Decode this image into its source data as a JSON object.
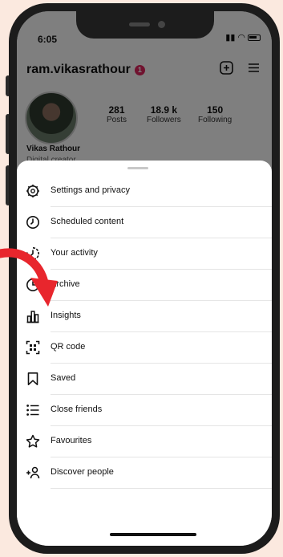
{
  "status": {
    "time": "6:05"
  },
  "profile": {
    "username": "ram.vikasrathour",
    "notification_count": "1",
    "name": "Vikas Rathour",
    "category": "Digital creator",
    "stats": [
      {
        "value": "281",
        "label": "Posts"
      },
      {
        "value": "18.9 k",
        "label": "Followers"
      },
      {
        "value": "150",
        "label": "Following"
      }
    ]
  },
  "menu": {
    "items": [
      {
        "label": "Settings and privacy",
        "icon": "settings-gear-icon"
      },
      {
        "label": "Scheduled content",
        "icon": "clock-icon"
      },
      {
        "label": "Your activity",
        "icon": "activity-icon"
      },
      {
        "label": "Archive",
        "icon": "archive-icon"
      },
      {
        "label": "Insights",
        "icon": "insights-bar-chart-icon"
      },
      {
        "label": "QR code",
        "icon": "qr-code-icon"
      },
      {
        "label": "Saved",
        "icon": "bookmark-icon"
      },
      {
        "label": "Close friends",
        "icon": "close-friends-list-icon"
      },
      {
        "label": "Favourites",
        "icon": "star-icon"
      },
      {
        "label": "Discover people",
        "icon": "add-person-icon"
      }
    ]
  },
  "colors": {
    "page_bg": "#fbe9df",
    "arrow": "#e8262d",
    "badge": "#e0245e"
  }
}
